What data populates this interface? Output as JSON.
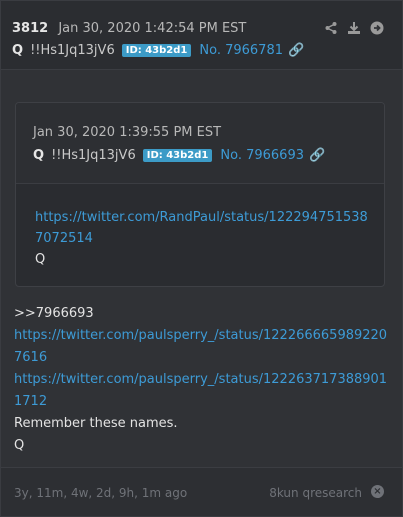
{
  "post": {
    "number": "3812",
    "date": "Jan 30, 2020 1:42:54 PM EST",
    "author": "Q",
    "tripcode": "!!Hs1Jq13jV6",
    "id_badge": "ID: 43b2d1",
    "post_no": "No. 7966781",
    "actions": [
      "share-icon",
      "download-icon",
      "navigate-icon"
    ]
  },
  "quoted": {
    "date": "Jan 30, 2020 1:39:55 PM EST",
    "author": "Q",
    "tripcode": "!!Hs1Jq13jV6",
    "id_badge": "ID: 43b2d1",
    "post_no": "No. 7966693",
    "link": "https://twitter.com/RandPaul/status/1222947515387072514",
    "text": "Q"
  },
  "body": {
    "reply_ref": ">>7966693",
    "link1": "https://twitter.com/paulsperry_/status/1222666659892207616",
    "link2": "https://twitter.com/paulsperry_/status/1222637173889011712",
    "message": "Remember these names.",
    "signature": "Q"
  },
  "footer": {
    "ago": "3y, 11m, 4w, 2d, 9h, 1m ago",
    "board": "8kun qresearch"
  }
}
